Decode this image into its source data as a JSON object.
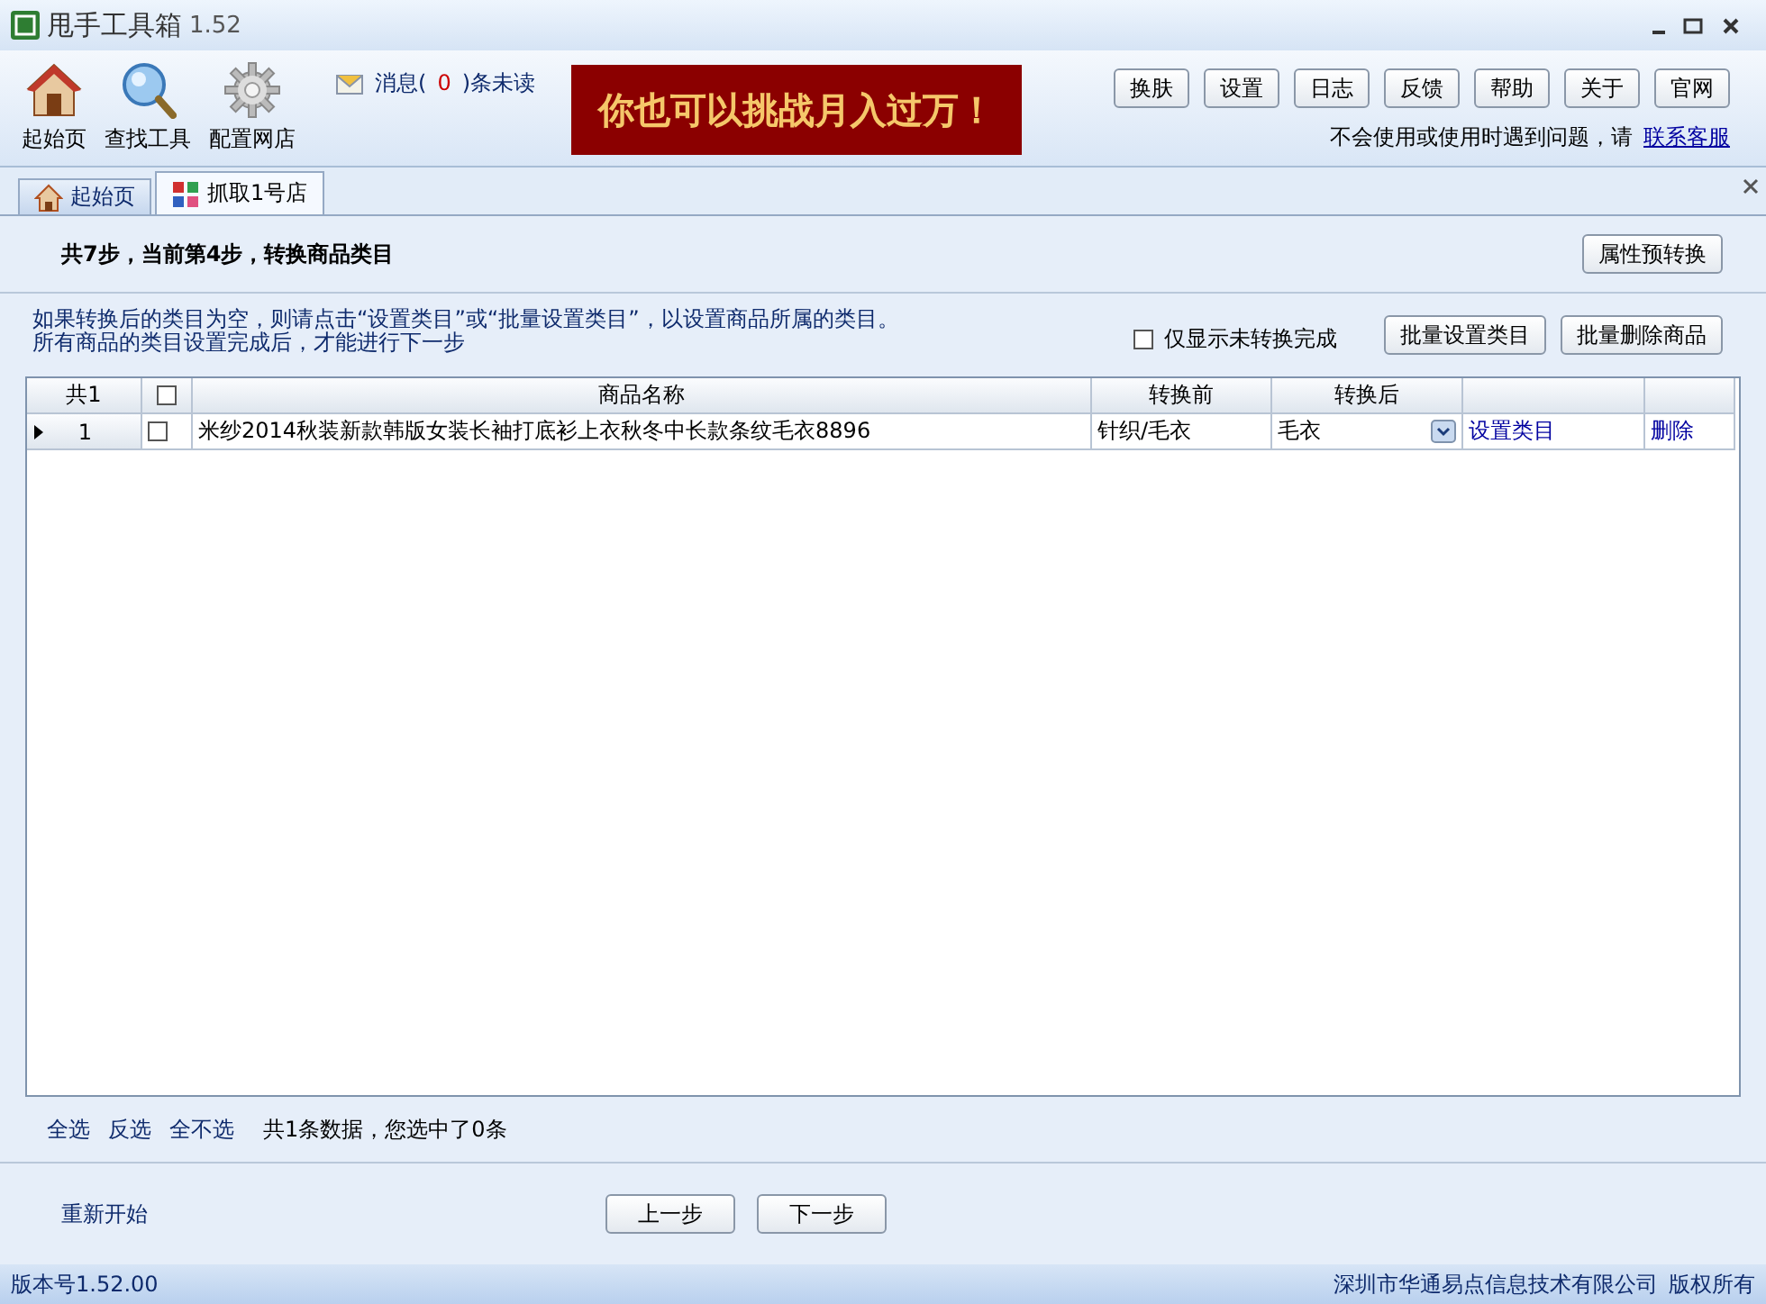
{
  "window": {
    "title": "甩手工具箱",
    "version": "1.52"
  },
  "toolbar": {
    "tools": [
      {
        "label": "起始页",
        "kind": "home"
      },
      {
        "label": "查找工具",
        "kind": "search"
      },
      {
        "label": "配置网店",
        "kind": "gear"
      }
    ],
    "message": {
      "prefix": "消息(",
      "count": "0",
      "suffix": ")条未读"
    },
    "banner": "你也可以挑战月入过万！",
    "buttons": [
      "换肤",
      "设置",
      "日志",
      "反馈",
      "帮助",
      "关于",
      "官网"
    ],
    "help": {
      "text": "不会使用或使用时遇到问题，请",
      "link": "联系客服"
    }
  },
  "tabs": [
    {
      "label": "起始页",
      "selected": false,
      "kind": "home"
    },
    {
      "label": "抓取1号店",
      "selected": true,
      "kind": "store"
    }
  ],
  "step": {
    "text": "共7步，当前第4步，转换商品类目",
    "button": "属性预转换"
  },
  "instructions": [
    "如果转换后的类目为空，则请点击“设置类目”或“批量设置类目”，以设置商品所属的类目。",
    "所有商品的类目设置完成后，才能进行下一步"
  ],
  "filter": {
    "label": "仅显示未转换完成",
    "checked": false
  },
  "actions": [
    "批量设置类目",
    "批量删除商品"
  ],
  "table": {
    "count_header": "共1",
    "header_checked": false,
    "columns": [
      "商品名称",
      "转换前",
      "转换后"
    ],
    "rows": [
      {
        "current": true,
        "number": "1",
        "checked": false,
        "name": "米纱2014秋装新款韩版女装长袖打底衫上衣秋冬中长款条纹毛衣8896",
        "before": "针织/毛衣",
        "after": "毛衣",
        "set_link": "设置类目",
        "delete_link": "删除"
      }
    ]
  },
  "selection_links": [
    "全选",
    "反选",
    "全不选"
  ],
  "summary": "共1条数据，您选中了0条",
  "restart": "重新开始",
  "nav_buttons": [
    "上一步",
    "下一步"
  ],
  "status_bar": {
    "version": "版本号1.52.00",
    "company": "深圳市华通易点信息技术有限公司",
    "rights": "版权所有"
  }
}
